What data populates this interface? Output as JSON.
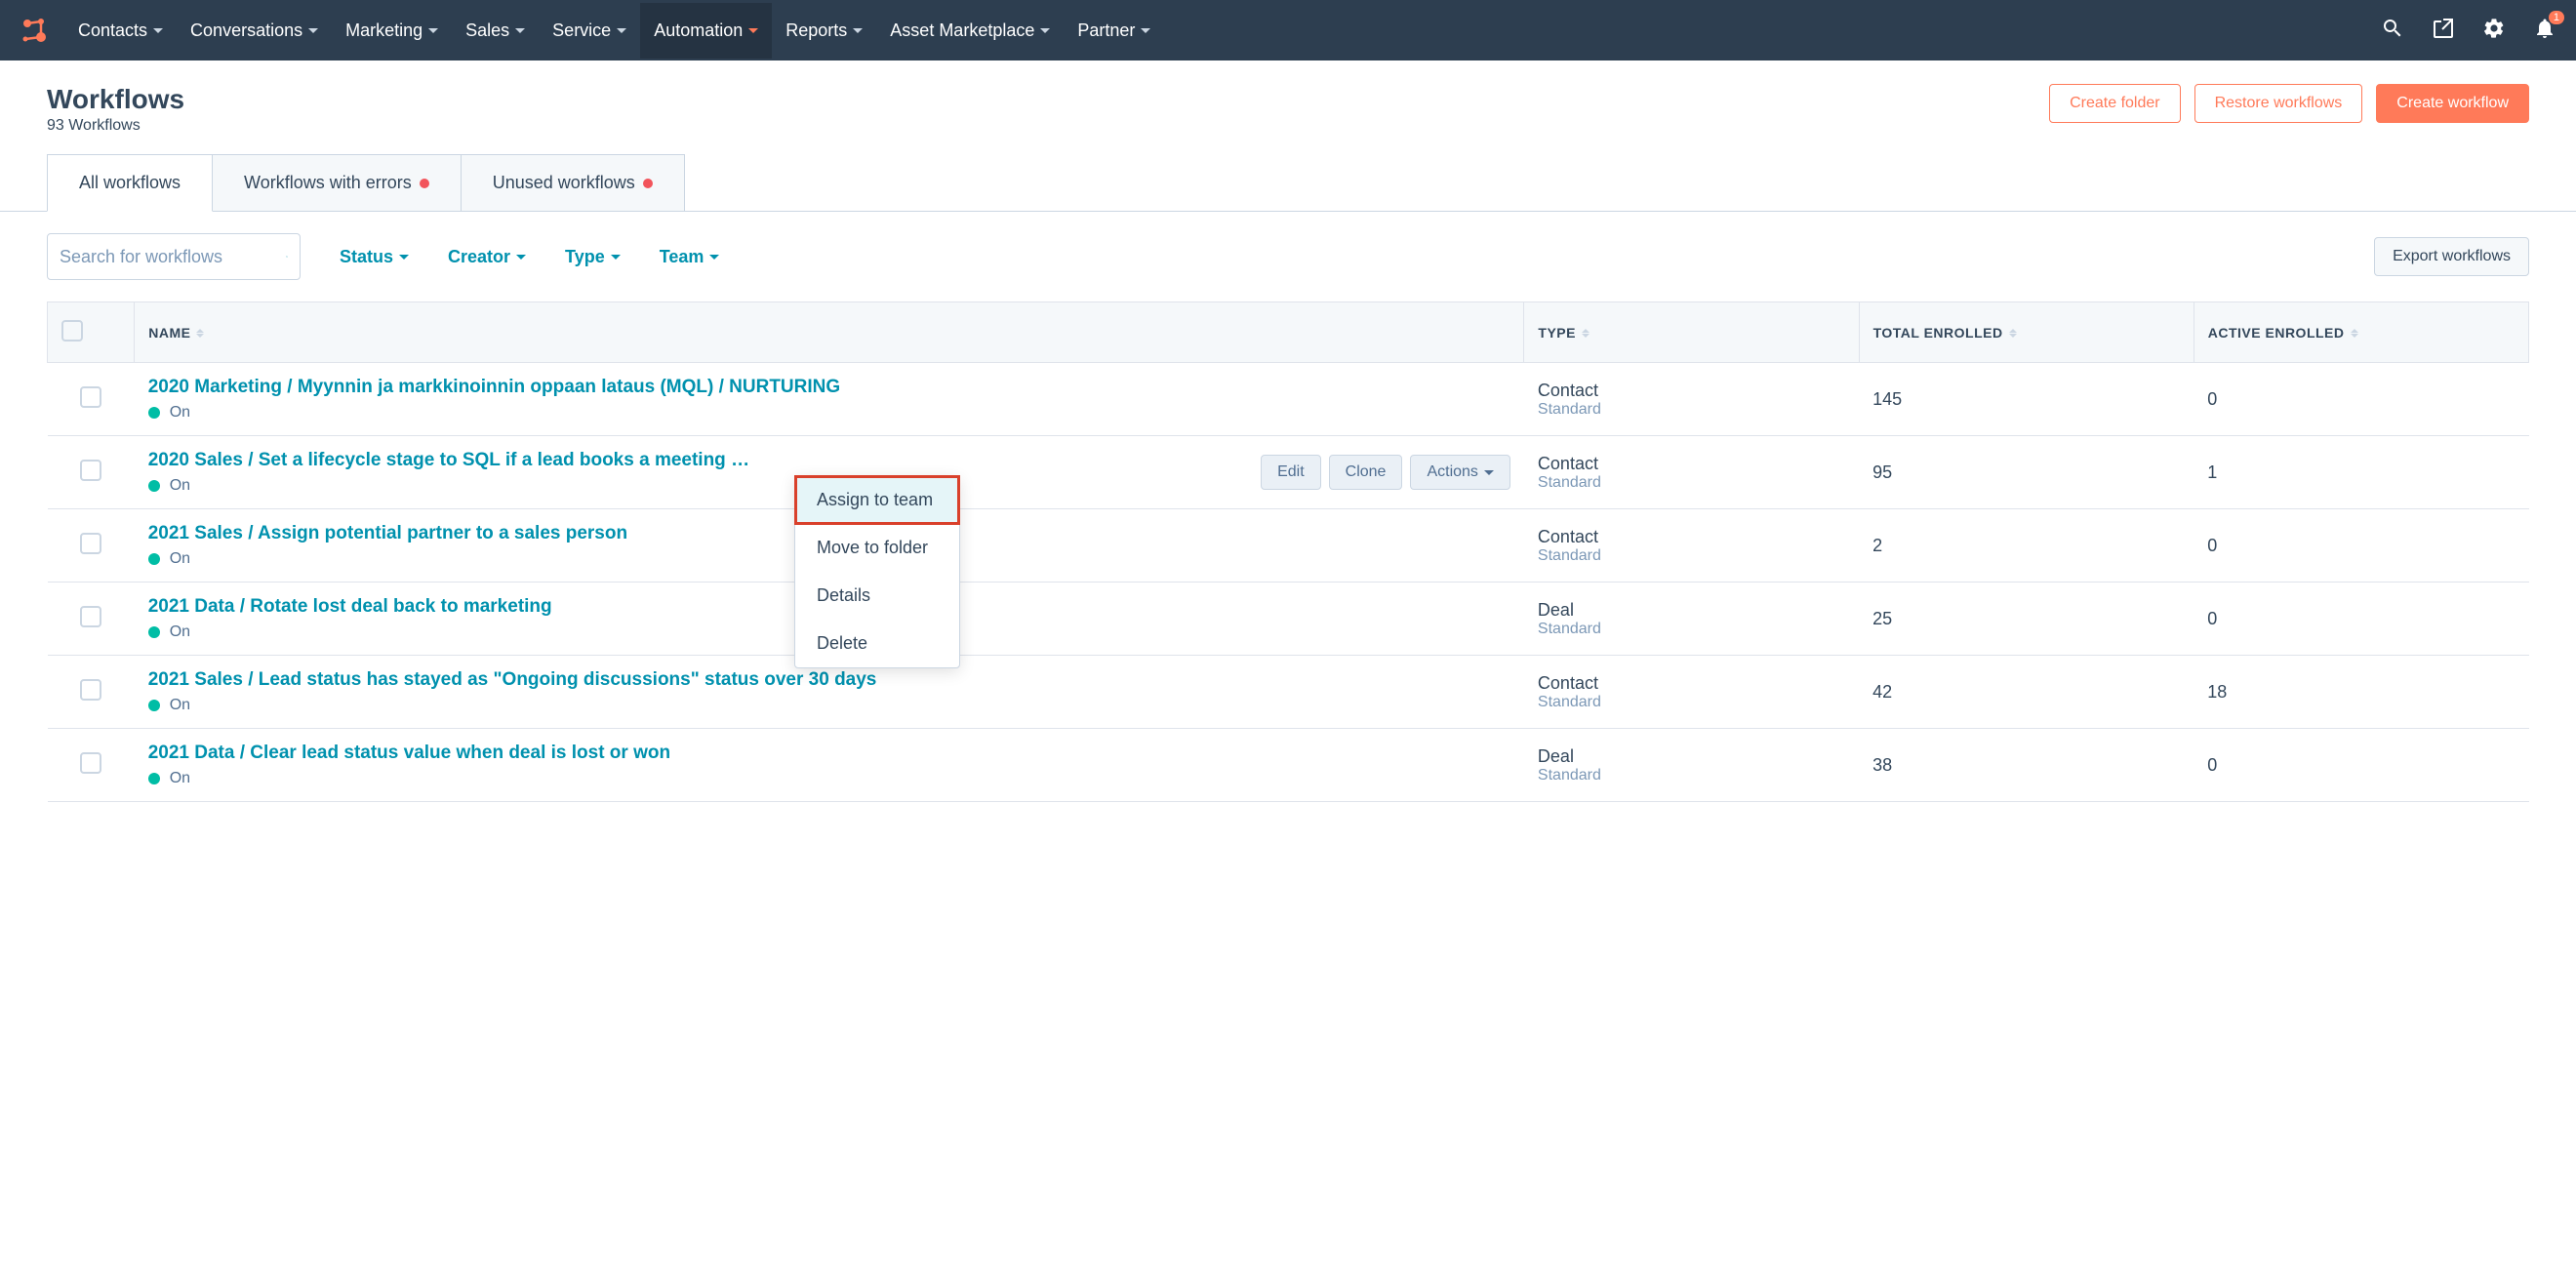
{
  "nav": {
    "items": [
      {
        "label": "Contacts"
      },
      {
        "label": "Conversations"
      },
      {
        "label": "Marketing"
      },
      {
        "label": "Sales"
      },
      {
        "label": "Service"
      },
      {
        "label": "Automation",
        "active": true
      },
      {
        "label": "Reports"
      },
      {
        "label": "Asset Marketplace"
      },
      {
        "label": "Partner"
      }
    ],
    "notif_count": "1"
  },
  "page": {
    "title": "Workflows",
    "subtitle": "93 Workflows"
  },
  "header_actions": {
    "create_folder": "Create folder",
    "restore": "Restore workflows",
    "create_workflow": "Create workflow"
  },
  "tabs": [
    {
      "label": "All workflows",
      "active": true,
      "dot": false
    },
    {
      "label": "Workflows with errors",
      "active": false,
      "dot": true
    },
    {
      "label": "Unused workflows",
      "active": false,
      "dot": true
    }
  ],
  "toolbar": {
    "search_placeholder": "Search for workflows",
    "filters": [
      {
        "label": "Status"
      },
      {
        "label": "Creator"
      },
      {
        "label": "Type"
      },
      {
        "label": "Team"
      }
    ],
    "export": "Export workflows"
  },
  "table": {
    "headers": {
      "name": "NAME",
      "type": "TYPE",
      "total": "TOTAL ENROLLED",
      "active": "ACTIVE ENROLLED"
    },
    "rows": [
      {
        "name": "2020 Marketing / Myynnin ja markkinoinnin oppaan lataus (MQL) / NURTURING",
        "status": "On",
        "type": "Contact",
        "subtype": "Standard",
        "total": "145",
        "active": "0"
      },
      {
        "name": "2020 Sales / Set a lifecycle stage to SQL if a lead books a meeting …",
        "status": "On",
        "type": "Contact",
        "subtype": "Standard",
        "total": "95",
        "active": "1",
        "hover": true
      },
      {
        "name": "2021 Sales / Assign potential partner to a sales person",
        "status": "On",
        "type": "Contact",
        "subtype": "Standard",
        "total": "2",
        "active": "0"
      },
      {
        "name": "2021 Data / Rotate lost deal back to marketing",
        "status": "On",
        "type": "Deal",
        "subtype": "Standard",
        "total": "25",
        "active": "0"
      },
      {
        "name": "2021 Sales / Lead status has stayed as \"Ongoing discussions\" status over 30 days",
        "status": "On",
        "type": "Contact",
        "subtype": "Standard",
        "total": "42",
        "active": "18"
      },
      {
        "name": "2021 Data / Clear lead status value when deal is lost or won",
        "status": "On",
        "type": "Deal",
        "subtype": "Standard",
        "total": "38",
        "active": "0"
      }
    ],
    "row_actions": {
      "edit": "Edit",
      "clone": "Clone",
      "actions": "Actions"
    }
  },
  "dropdown": {
    "items": [
      {
        "label": "Assign to team",
        "highlighted": true
      },
      {
        "label": "Move to folder"
      },
      {
        "label": "Details"
      },
      {
        "label": "Delete"
      }
    ]
  }
}
